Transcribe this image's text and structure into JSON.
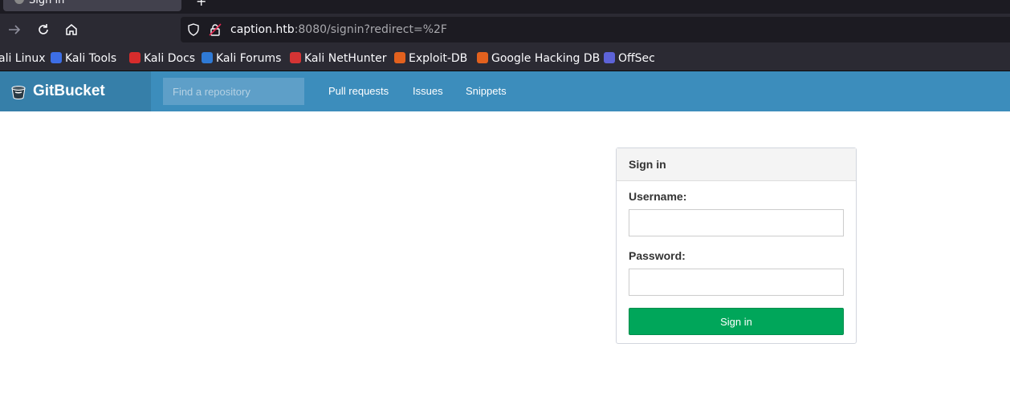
{
  "browser": {
    "tab_title": "Sign in",
    "new_tab_label": "+",
    "url_host": "caption.htb",
    "url_rest": ":8080/signin?redirect=%2F",
    "bookmarks": [
      {
        "label": "ali Linux",
        "icon": "kali-icon",
        "color": "#2b2a33"
      },
      {
        "label": "Kali Tools",
        "icon": "kali-tools-icon",
        "color": "#3d6ee6"
      },
      {
        "label": "Kali Docs",
        "icon": "kali-docs-icon",
        "color": "#d72c2c"
      },
      {
        "label": "Kali Forums",
        "icon": "kali-forums-icon",
        "color": "#2f7ad6"
      },
      {
        "label": "Kali NetHunter",
        "icon": "kali-nethunter-icon",
        "color": "#d43434"
      },
      {
        "label": "Exploit-DB",
        "icon": "exploit-db-icon",
        "color": "#e2611e"
      },
      {
        "label": "Google Hacking DB",
        "icon": "ghdb-icon",
        "color": "#e2611e"
      },
      {
        "label": "OffSec",
        "icon": "offsec-icon",
        "color": "#5d63d8"
      }
    ]
  },
  "app": {
    "brand": "GitBucket",
    "search_placeholder": "Find a repository",
    "nav": [
      "Pull requests",
      "Issues",
      "Snippets"
    ],
    "header_color": "#3c8dbc"
  },
  "signin": {
    "title": "Sign in",
    "username_label": "Username:",
    "username_value": "",
    "password_label": "Password:",
    "password_value": "",
    "submit_label": "Sign in",
    "submit_color": "#00a65a"
  }
}
